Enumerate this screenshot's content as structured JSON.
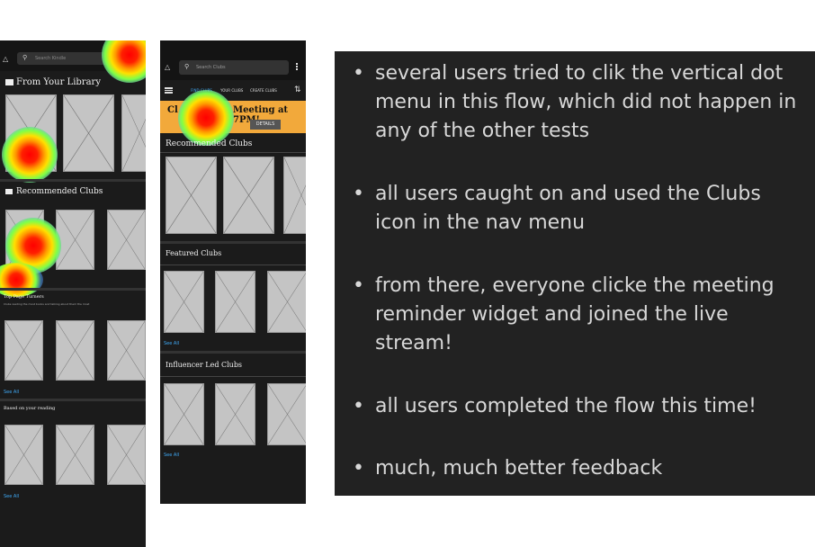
{
  "screen1": {
    "search_placeholder": "Search Kindle",
    "library_title": "From Your Library",
    "recommended_title": "Recommended Clubs",
    "top_title": "Top Page Turners",
    "top_sub": "Clubs reading the most books and talking about them the most",
    "see_all_1": "See All",
    "based_title": "Based on your reading",
    "see_all_2": "See All"
  },
  "screen2": {
    "search_placeholder": "Search Clubs",
    "tabs": [
      "FIND CLUBS",
      "YOUR CLUBS",
      "CREATE CLUBS"
    ],
    "banner_left": "Cl",
    "banner_right": "Meeting at 7PM!",
    "details_label": "DETAILS",
    "recommended_title": "Recommended Clubs",
    "featured_title": "Featured Clubs",
    "see_all_1": "See All",
    "influencer_title": "Influencer Led Clubs",
    "see_all_2": "See All"
  },
  "notes": {
    "items": [
      "several users tried to clik the vertical dot menu in this flow, which did not happen in any of the other tests",
      "all users caught on and used the Clubs icon in the nav menu",
      "from there, everyone clicke the meeting reminder widget and joined the live stream!",
      "all users completed the flow this time!",
      "much, much better feedback"
    ]
  },
  "colors": {
    "phone_bg": "#1b1b1b",
    "notes_bg": "#222222",
    "banner": "#f2a93b",
    "link": "#3fa9f5"
  }
}
